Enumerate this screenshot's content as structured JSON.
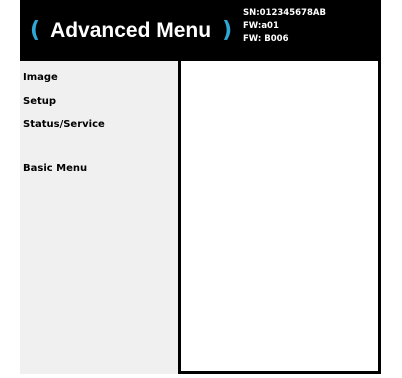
{
  "header": {
    "open_paren": "(",
    "title": "Advanced Menu",
    "close_paren": ")",
    "serial": "SN:012345678AB",
    "firmware_1": "FW:a01",
    "firmware_2": "FW: B006"
  },
  "menu": {
    "items": [
      {
        "label": "Image"
      },
      {
        "label": "Setup"
      },
      {
        "label": "Status/Service"
      },
      {
        "label": "Basic Menu"
      }
    ]
  },
  "colors": {
    "background": "#000000",
    "accent_paren": "#2fa8d8",
    "sidebar": "#f0f0f0",
    "content": "#ffffff",
    "text_light": "#ffffff",
    "text_dark": "#000000"
  }
}
